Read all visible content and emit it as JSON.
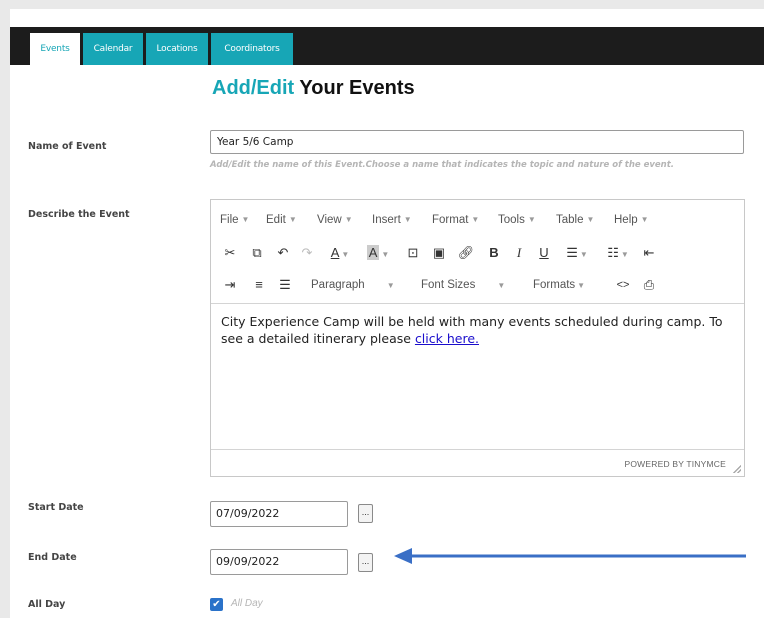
{
  "tabs": [
    {
      "label": "Events",
      "active": true
    },
    {
      "label": "Calendar",
      "active": false
    },
    {
      "label": "Locations",
      "active": false
    },
    {
      "label": "Coordinators",
      "active": false
    }
  ],
  "page_title": {
    "accent": "Add/Edit",
    "rest": " Your Events"
  },
  "fields": {
    "name": {
      "label": "Name of Event",
      "value": "Year 5/6 Camp",
      "hint": "Add/Edit the name of this Event.Choose a name that indicates the topic and nature of the event."
    },
    "describe": {
      "label": "Describe the Event"
    },
    "start_date": {
      "label": "Start Date",
      "value": "07/09/2022"
    },
    "end_date": {
      "label": "End Date",
      "value": "09/09/2022"
    },
    "all_day": {
      "label": "All Day",
      "checkbox_text": "All Day",
      "checked": true
    }
  },
  "editor": {
    "menu": [
      "File",
      "Edit",
      "View",
      "Insert",
      "Format",
      "Tools",
      "Table",
      "Help"
    ],
    "toolbar2_labels": {
      "paragraph": "Paragraph",
      "font_sizes": "Font Sizes",
      "formats": "Formats"
    },
    "content_text": "City Experience Camp will be held with many events scheduled during camp. To see a detailed itinerary please ",
    "content_link": "click here.",
    "powered_by": "POWERED BY TINYMCE"
  },
  "date_button_label": "...",
  "colors": {
    "accent": "#17a6b6",
    "topbar": "#1c1c1c",
    "arrow": "#3a6fc6",
    "checkbox": "#2a72c9"
  },
  "icons": [
    "cut-icon",
    "copy-icon",
    "undo-icon",
    "redo-icon",
    "text-color-icon",
    "background-color-icon",
    "media-icon",
    "image-icon",
    "link-icon",
    "bold-icon",
    "italic-icon",
    "underline-icon",
    "bullet-list-icon",
    "numbered-list-icon",
    "outdent-icon",
    "indent-icon",
    "align-left-icon",
    "align-center-icon",
    "code-icon",
    "print-icon",
    "calendar-picker-icon",
    "annotation-arrow-icon",
    "checkbox-check-icon"
  ]
}
